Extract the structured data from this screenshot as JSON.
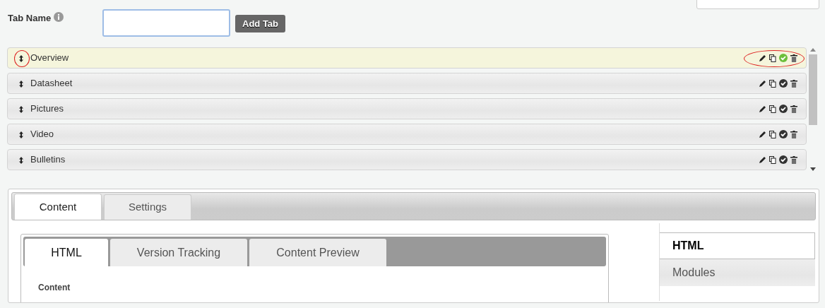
{
  "tab_name": {
    "label": "Tab Name"
  },
  "add_button": "Add Tab",
  "tabs": [
    {
      "label": "Overview",
      "selected": true,
      "annotated": true
    },
    {
      "label": "Datasheet",
      "selected": false,
      "annotated": false
    },
    {
      "label": "Pictures",
      "selected": false,
      "annotated": false
    },
    {
      "label": "Video",
      "selected": false,
      "annotated": false
    },
    {
      "label": "Bulletins",
      "selected": false,
      "annotated": false
    }
  ],
  "editor_tabs": [
    {
      "label": "Content",
      "selected": true
    },
    {
      "label": "Settings",
      "selected": false
    }
  ],
  "content_tabs": [
    {
      "label": "HTML",
      "selected": true
    },
    {
      "label": "Version Tracking",
      "selected": false
    },
    {
      "label": "Content Preview",
      "selected": false
    }
  ],
  "content_label": "Content",
  "side_tabs": [
    {
      "label": "HTML",
      "selected": true
    },
    {
      "label": "Modules",
      "selected": false
    }
  ]
}
